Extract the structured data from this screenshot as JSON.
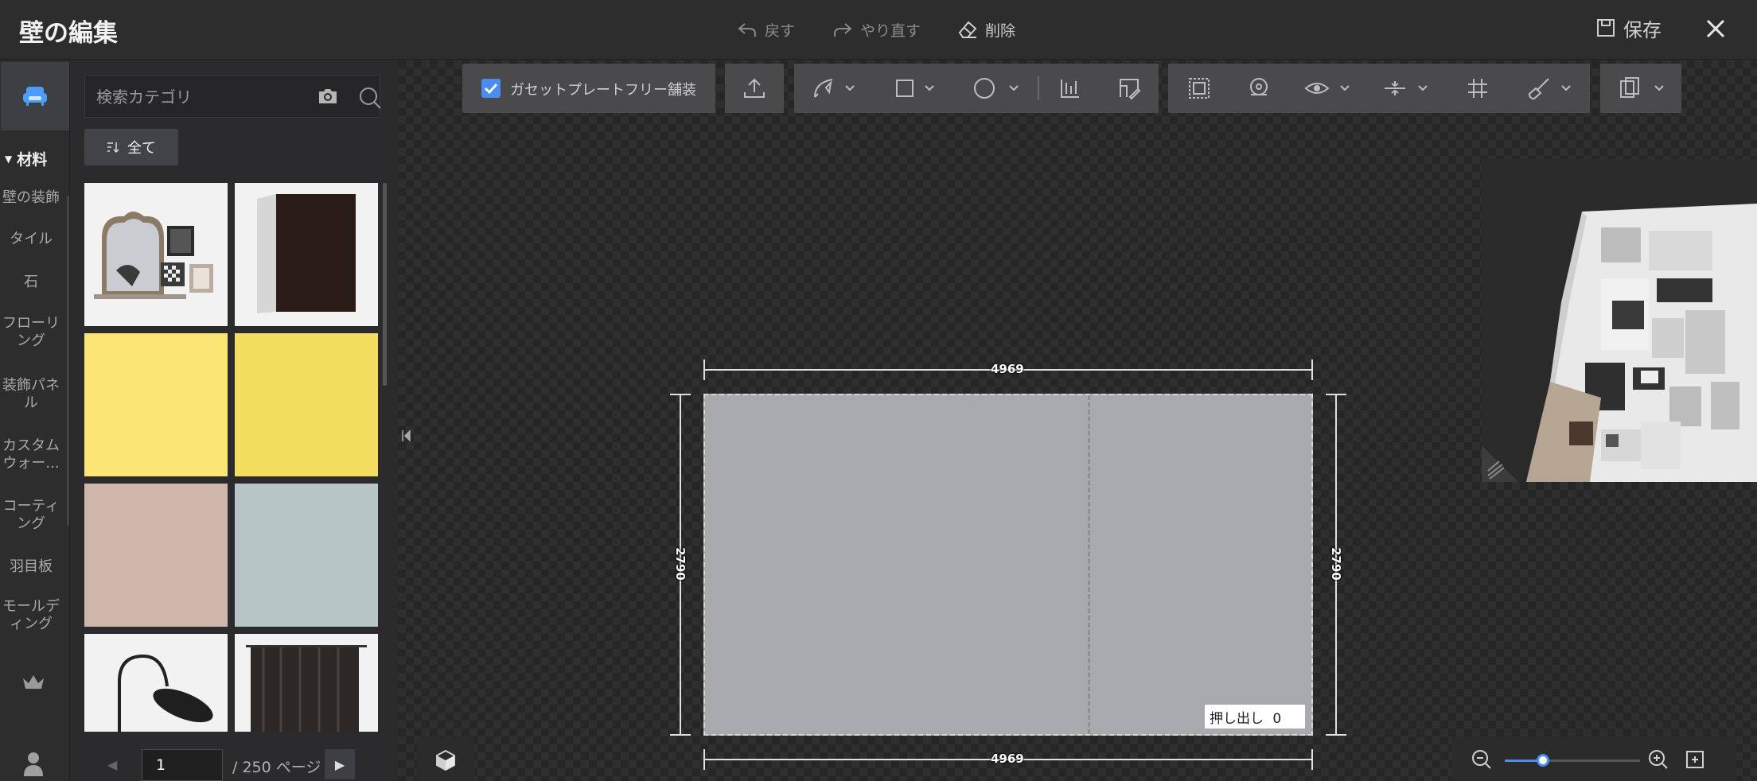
{
  "header": {
    "title": "壁の編集",
    "undo_label": "戻す",
    "redo_label": "やり直す",
    "delete_label": "削除",
    "save_label": "保存"
  },
  "rail": {
    "section_label": "材料",
    "items": [
      {
        "label": "壁の装飾"
      },
      {
        "label": "タイル"
      },
      {
        "label": "石"
      },
      {
        "label": "フローリ\nング"
      },
      {
        "label": "装飾パネ\nル"
      },
      {
        "label": "カスタム\nウォー..."
      },
      {
        "label": "コーティ\nング"
      },
      {
        "label": "羽目板"
      },
      {
        "label": "モールデ\nィング"
      }
    ]
  },
  "panel": {
    "search_placeholder": "検索カテゴリ",
    "filter_label": "全て",
    "tiles": [
      {
        "name": "tile-mirror-decor"
      },
      {
        "name": "tile-dark-panel"
      },
      {
        "name": "tile-yellow-1",
        "color": "#fbe675"
      },
      {
        "name": "tile-yellow-2",
        "color": "#f3de5f"
      },
      {
        "name": "tile-pink",
        "color": "#ceb6aa"
      },
      {
        "name": "tile-sage",
        "color": "#b7c6c5"
      },
      {
        "name": "tile-lamp"
      },
      {
        "name": "tile-curtain"
      }
    ],
    "page_value": "1",
    "page_total": "/ 250 ページ"
  },
  "toolbar": {
    "gusset_label": "ガセットプレートフリー舗装",
    "gusset_checked": true
  },
  "wall": {
    "width_top": "4969",
    "width_bottom": "4969",
    "height_left": "2790",
    "height_right": "2790",
    "extrude_label": "押し出し",
    "extrude_value": "0"
  },
  "zoom": {
    "level": 0.28
  },
  "colors": {
    "accent": "#4a8cf0",
    "wall_fill": "#a8aaae"
  }
}
